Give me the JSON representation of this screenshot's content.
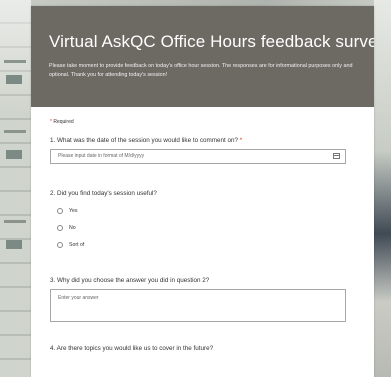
{
  "form": {
    "title": "Virtual AskQC Office Hours feedback survey",
    "description": "Please take moment to provide feedback on today's office hour session. The responses are for informational purposes only and optional. Thank you for attending today's session!",
    "required_note": "Required"
  },
  "questions": [
    {
      "number": "1.",
      "text": "What was the date of the session you would like to comment on?",
      "required": true,
      "placeholder": "Please input date in format of M/d/yyyy"
    },
    {
      "number": "2.",
      "text": "Did you find today's session useful?",
      "options": [
        "Yes",
        "No",
        "Sort of"
      ]
    },
    {
      "number": "3.",
      "text": "Why did you choose the answer you did in question 2?",
      "placeholder": "Enter your answer"
    },
    {
      "number": "4.",
      "text": "Are there topics you would like us to cover in the future?"
    }
  ],
  "icons": {
    "date_picker": "calendar-icon"
  },
  "colors": {
    "header": "#6d6a64",
    "required_star": "#d83b01"
  }
}
